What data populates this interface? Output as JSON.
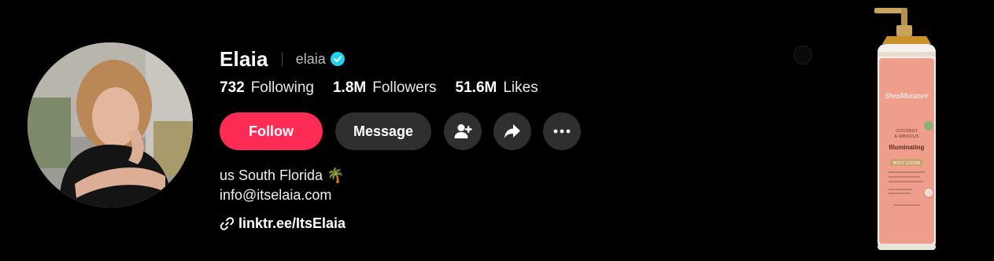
{
  "profile": {
    "display_name": "Elaia",
    "username": "elaia",
    "verified_icon": "verified-check-icon",
    "verified_color": "#20d5ec"
  },
  "stats": [
    {
      "value": "732",
      "label": "Following"
    },
    {
      "value": "1.8M",
      "label": "Followers"
    },
    {
      "value": "51.6M",
      "label": "Likes"
    }
  ],
  "actions": {
    "follow_label": "Follow",
    "message_label": "Message",
    "add_friend_icon": "add-user-icon",
    "share_icon": "share-icon",
    "more_icon": "more-icon"
  },
  "bio": {
    "line1": "us South Florida 🌴",
    "line2": "info@itselaia.com",
    "link": "linktr.ee/ItsElaia",
    "link_icon": "link-icon"
  },
  "ad": {
    "brand": "SheaMoisture",
    "flavor_line1": "COCONUT",
    "flavor_line2": "& HIBISCUS",
    "product_name": "Illuminating",
    "product_type": "BODY LOTION"
  },
  "colors": {
    "background": "#000000",
    "accent": "#fe2c55",
    "button_dark": "#2f2f2f"
  }
}
